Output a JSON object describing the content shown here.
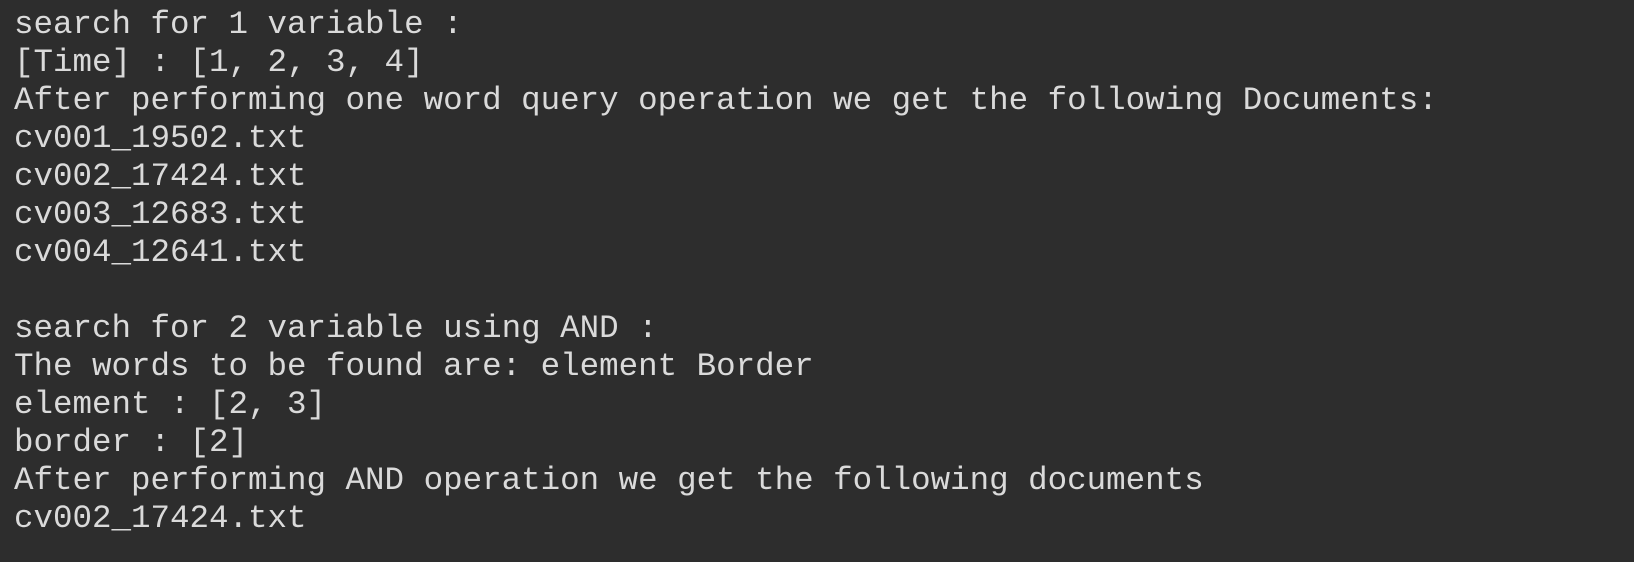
{
  "output": {
    "block1": {
      "header": "search for 1 variable :",
      "postings": "[Time] : [1, 2, 3, 4]",
      "result_intro": "After performing one word query operation we get the following Documents:",
      "documents": [
        "cv001_19502.txt",
        "cv002_17424.txt",
        "cv003_12683.txt",
        "cv004_12641.txt"
      ]
    },
    "block2": {
      "header": "search for 2 variable using AND :",
      "words_line": "The words to be found are: element Border",
      "postings": [
        "element : [2, 3]",
        "border : [2]"
      ],
      "result_intro": "After performing AND operation we get the following documents",
      "documents": [
        "cv002_17424.txt"
      ]
    }
  }
}
